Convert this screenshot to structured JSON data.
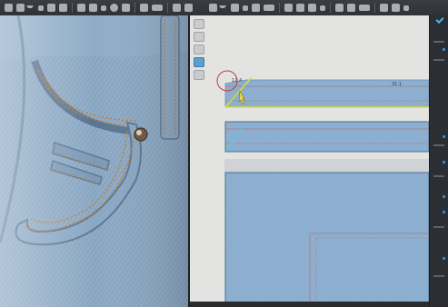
{
  "toolbar": {
    "groups": [
      {
        "icons": [
          "select-icon",
          "move-icon",
          "rotate-icon",
          "scale-icon",
          "fold-icon"
        ]
      },
      {
        "icons": [
          "brush-icon",
          "paint-icon",
          "pin-icon",
          "tack-icon",
          "sphere-icon",
          "avatar-icon",
          "garment-icon"
        ]
      },
      {
        "icons": [
          "grid-icon",
          "layers-icon",
          "render-icon"
        ]
      },
      {
        "icons": [
          "edit-pattern-icon",
          "transform-icon",
          "point-icon",
          "curve-icon",
          "seam-icon",
          "segment-icon",
          "polygon-icon",
          "rectangle-icon"
        ]
      },
      {
        "icons": [
          "internal-line-icon",
          "dart-icon",
          "offset-icon",
          "sewing-icon",
          "free-sewing-icon",
          "fold-sewing-icon",
          "topstitch-icon",
          "button-icon"
        ]
      }
    ]
  },
  "pattern_window": {
    "measure_left": "12.4",
    "measure_right": "31.1"
  },
  "colors": {
    "denim": "#8fb2d2",
    "denim_dark": "#6f93b5",
    "stitch": "#c77b2c",
    "selection": "#d7e22c",
    "cut_line": "#c0595e",
    "circle": "#c9393a",
    "accent": "#4bb3e6"
  }
}
